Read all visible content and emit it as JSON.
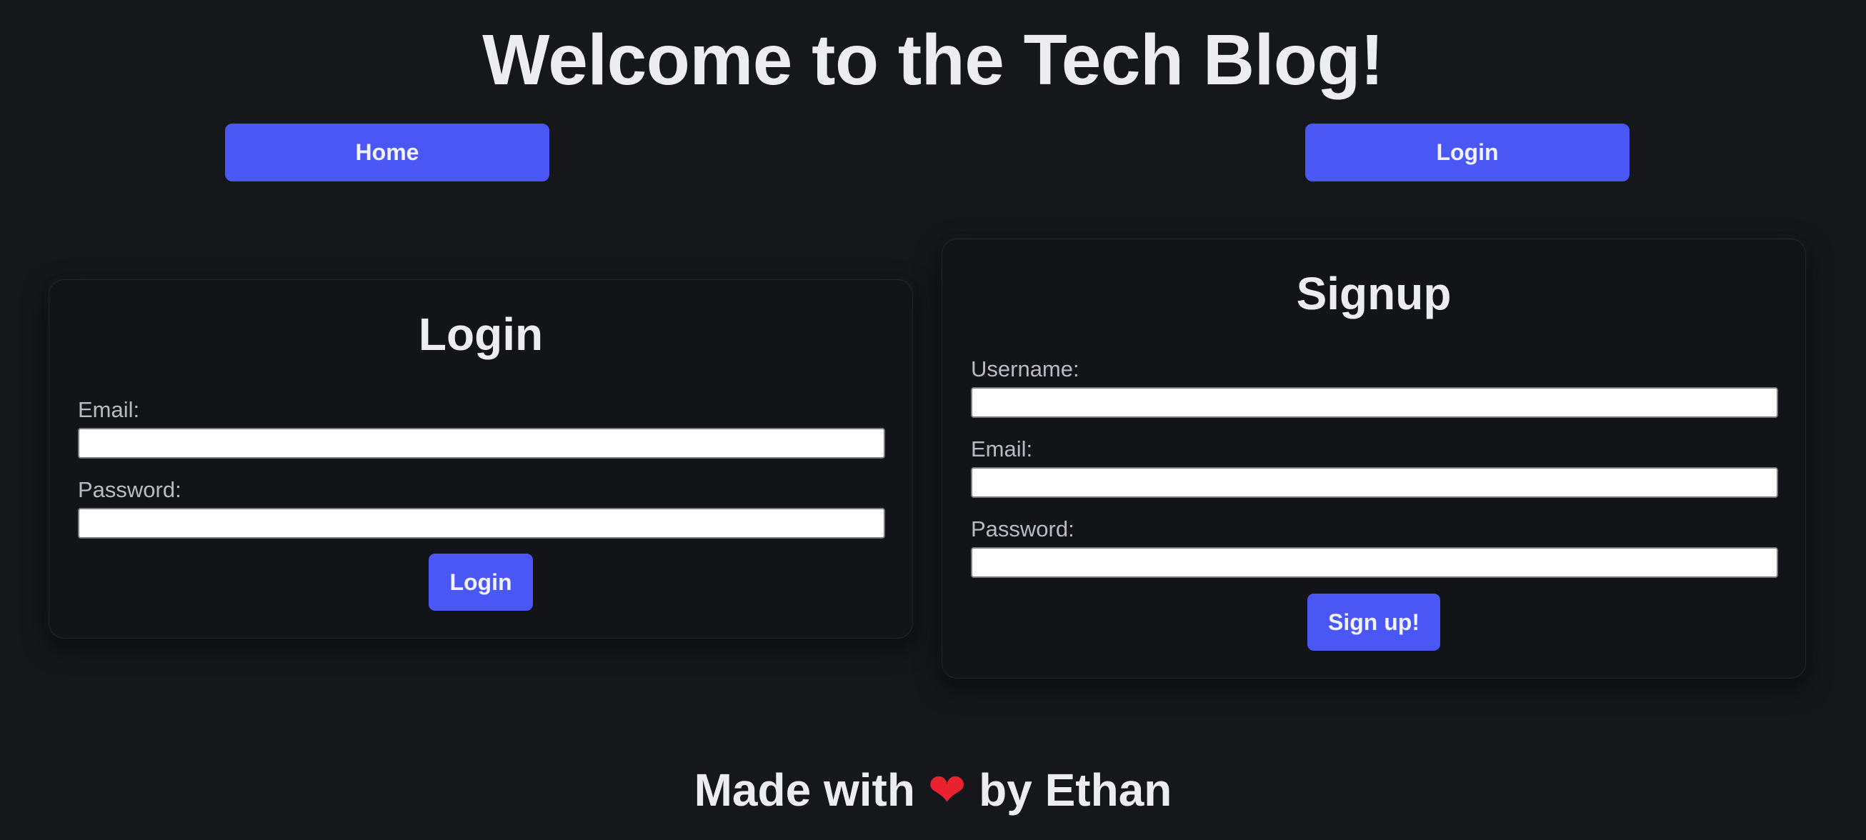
{
  "header": {
    "title": "Welcome to the Tech Blog!"
  },
  "nav": {
    "home_label": "Home",
    "login_label": "Login"
  },
  "login_card": {
    "title": "Login",
    "email_label": "Email:",
    "email_value": "",
    "password_label": "Password:",
    "password_value": "",
    "submit_label": "Login"
  },
  "signup_card": {
    "title": "Signup",
    "username_label": "Username:",
    "username_value": "",
    "email_label": "Email:",
    "email_value": "",
    "password_label": "Password:",
    "password_value": "",
    "submit_label": "Sign up!"
  },
  "footer": {
    "prefix": "Made with",
    "heart": "❤",
    "suffix": "by Ethan"
  },
  "colors": {
    "background": "#16171b",
    "accent": "#4b57f5",
    "card": "#131417",
    "heart": "#e8232f"
  }
}
